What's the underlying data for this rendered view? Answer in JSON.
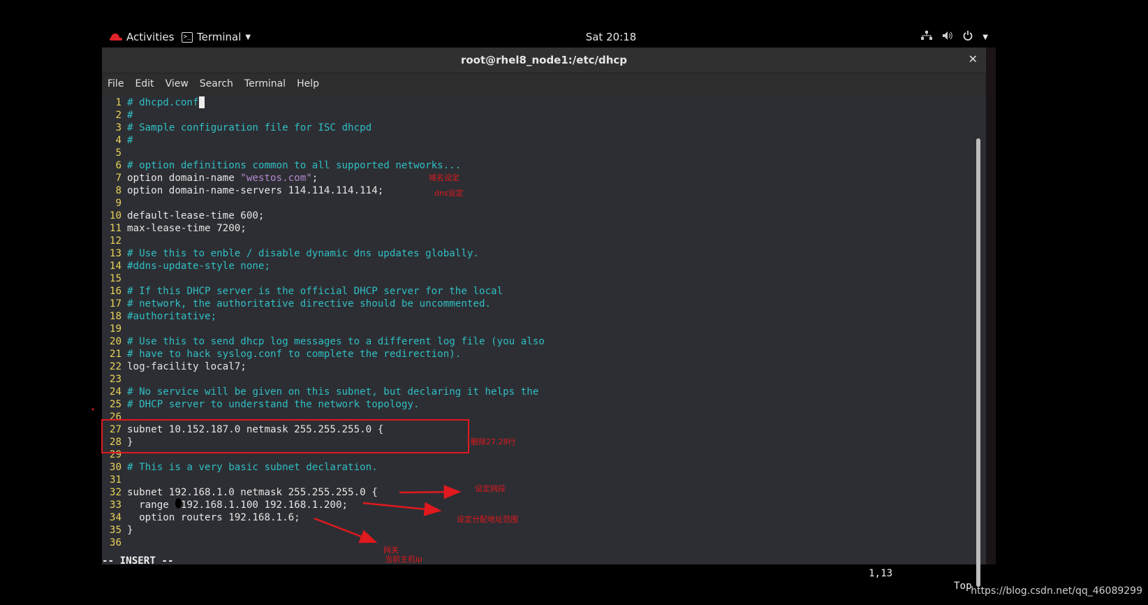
{
  "topbar": {
    "activities": "Activities",
    "app_menu": "Terminal",
    "clock": "Sat 20:18"
  },
  "window": {
    "title": "root@rhel8_node1:/etc/dhcp",
    "close_glyph": "✕"
  },
  "menu": [
    "File",
    "Edit",
    "View",
    "Search",
    "Terminal",
    "Help"
  ],
  "editor": {
    "lines": [
      {
        "n": "1",
        "t": "# dhcpd.conf",
        "k": "com",
        "cursor": true
      },
      {
        "n": "2",
        "t": "#",
        "k": "com"
      },
      {
        "n": "3",
        "t": "# Sample configuration file for ISC dhcpd",
        "k": "com"
      },
      {
        "n": "4",
        "t": "#",
        "k": "com"
      },
      {
        "n": "5",
        "t": "",
        "k": "txt"
      },
      {
        "n": "6",
        "t": "# option definitions common to all supported networks...",
        "k": "com"
      },
      {
        "n": "7",
        "t": "option domain-name ",
        "k": "txt",
        "str": "\"westos.com\"",
        "after": ";"
      },
      {
        "n": "8",
        "t": "option domain-name-servers 114.114.114.114;",
        "k": "txt"
      },
      {
        "n": "9",
        "t": "",
        "k": "txt"
      },
      {
        "n": "10",
        "t": "default-lease-time 600;",
        "k": "txt"
      },
      {
        "n": "11",
        "t": "max-lease-time 7200;",
        "k": "txt"
      },
      {
        "n": "12",
        "t": "",
        "k": "txt"
      },
      {
        "n": "13",
        "t": "# Use this to enble / disable dynamic dns updates globally.",
        "k": "com"
      },
      {
        "n": "14",
        "t": "#ddns-update-style none;",
        "k": "com"
      },
      {
        "n": "15",
        "t": "",
        "k": "txt"
      },
      {
        "n": "16",
        "t": "# If this DHCP server is the official DHCP server for the local",
        "k": "com"
      },
      {
        "n": "17",
        "t": "# network, the authoritative directive should be uncommented.",
        "k": "com"
      },
      {
        "n": "18",
        "t": "#authoritative;",
        "k": "com"
      },
      {
        "n": "19",
        "t": "",
        "k": "txt"
      },
      {
        "n": "20",
        "t": "# Use this to send dhcp log messages to a different log file (you also",
        "k": "com"
      },
      {
        "n": "21",
        "t": "# have to hack syslog.conf to complete the redirection).",
        "k": "com"
      },
      {
        "n": "22",
        "t": "log-facility local7;",
        "k": "txt"
      },
      {
        "n": "23",
        "t": "",
        "k": "txt"
      },
      {
        "n": "24",
        "t": "# No service will be given on this subnet, but declaring it helps the",
        "k": "com"
      },
      {
        "n": "25",
        "t": "# DHCP server to understand the network topology.",
        "k": "com"
      },
      {
        "n": "26",
        "t": "",
        "k": "txt"
      },
      {
        "n": "27",
        "t": "subnet 10.152.187.0 netmask 255.255.255.0 {",
        "k": "txt"
      },
      {
        "n": "28",
        "t": "}",
        "k": "txt"
      },
      {
        "n": "29",
        "t": "",
        "k": "txt"
      },
      {
        "n": "30",
        "t": "# This is a very basic subnet declaration.",
        "k": "com"
      },
      {
        "n": "31",
        "t": "",
        "k": "txt"
      },
      {
        "n": "32",
        "t": "subnet 192.168.1.0 netmask 255.255.255.0 {",
        "k": "txt"
      },
      {
        "n": "33",
        "t": "  range  192.168.1.100 192.168.1.200;",
        "k": "txt"
      },
      {
        "n": "34",
        "t": "  option routers 192.168.1.6;",
        "k": "txt"
      },
      {
        "n": "35",
        "t": "}",
        "k": "txt"
      },
      {
        "n": "36",
        "t": "",
        "k": "txt"
      }
    ],
    "mode": "-- INSERT --",
    "position": "1,13",
    "scroll_pos": "Top"
  },
  "annotations": {
    "domain_name": "域名设定",
    "dns": "dns设定",
    "delete_lines": "删除27.28行",
    "subnet": "设定网段",
    "range": "设定分配地址范围",
    "gateway_1": "网关",
    "gateway_2": "当前主机ip"
  },
  "colors": {
    "comment": "#2fbfc4",
    "line_number": "#e9d35a",
    "string": "#b58acf",
    "annotation_red": "#e0191e"
  },
  "watermark": "https://blog.csdn.net/qq_46089299"
}
